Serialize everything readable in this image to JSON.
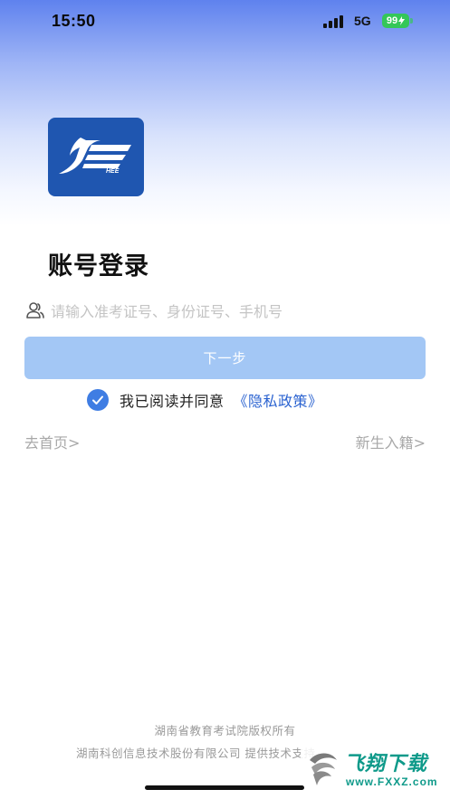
{
  "status_bar": {
    "time": "15:50",
    "network": "5G",
    "battery": "99"
  },
  "logo": {
    "text": "HEE"
  },
  "login": {
    "title": "账号登录",
    "account_placeholder": "请输入准考证号、身份证号、手机号",
    "next_label": "下一步",
    "agree_text": "我已阅读并同意",
    "privacy_link": "《隐私政策》",
    "agree_checked": true,
    "home_link": "去首页>",
    "enroll_link": "新生入籍>"
  },
  "footer": {
    "line1": "湖南省教育考试院版权所有",
    "line2": "湖南科创信息技术股份有限公司 提供技术支持"
  },
  "watermark": {
    "name": "飞翔下载",
    "url": "www.FXXZ.com"
  },
  "colors": {
    "accent": "#3f7de3",
    "button_disabled": "#a3c7f5",
    "logo_bg": "#1f56b0",
    "link": "#2a62d0",
    "battery": "#34c759"
  }
}
